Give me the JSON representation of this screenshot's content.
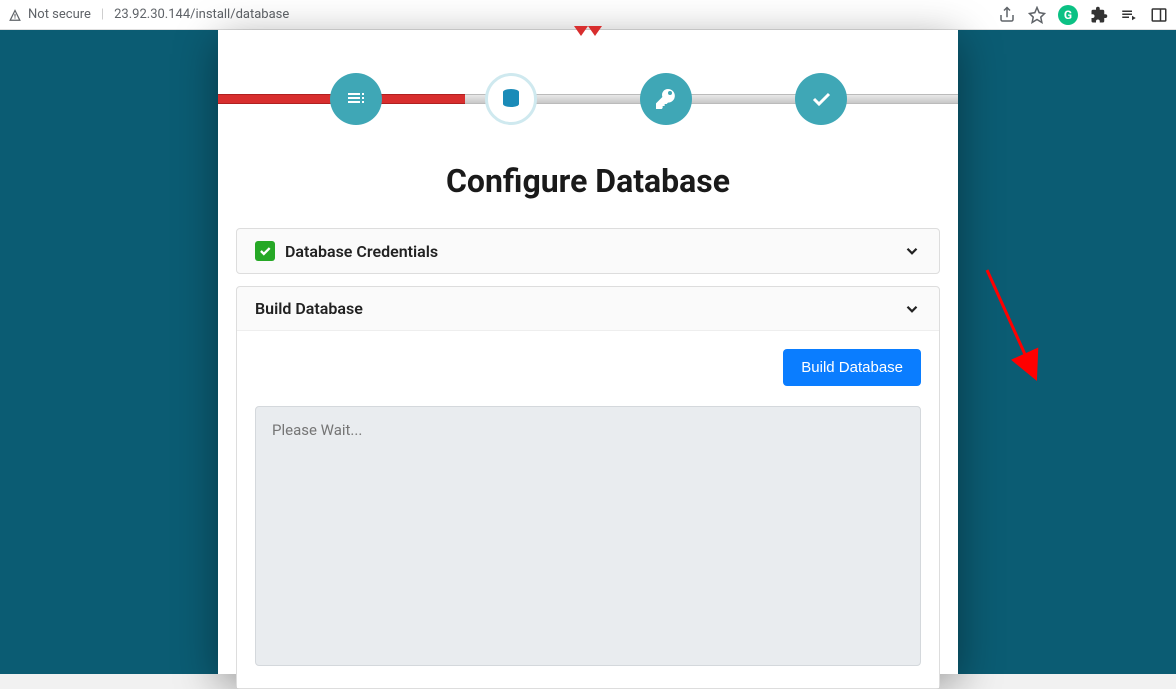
{
  "browser": {
    "security_label": "Not secure",
    "url": "23.92.30.144/install/database"
  },
  "page": {
    "title": "Configure Database"
  },
  "steps": {
    "items": [
      {
        "name": "list-icon",
        "state": "done"
      },
      {
        "name": "database-icon",
        "state": "active"
      },
      {
        "name": "key-icon",
        "state": "pending"
      },
      {
        "name": "check-icon",
        "state": "pending"
      }
    ]
  },
  "accordion": {
    "credentials": {
      "label": "Database Credentials",
      "completed": true,
      "expanded": false
    },
    "build": {
      "label": "Build Database",
      "expanded": true,
      "button_label": "Build Database",
      "output_placeholder": "Please Wait..."
    }
  },
  "colors": {
    "accent_teal": "#3fa7b6",
    "accent_red": "#d82e2e",
    "primary_blue": "#0a7dff",
    "page_bg": "#0b5c73"
  }
}
